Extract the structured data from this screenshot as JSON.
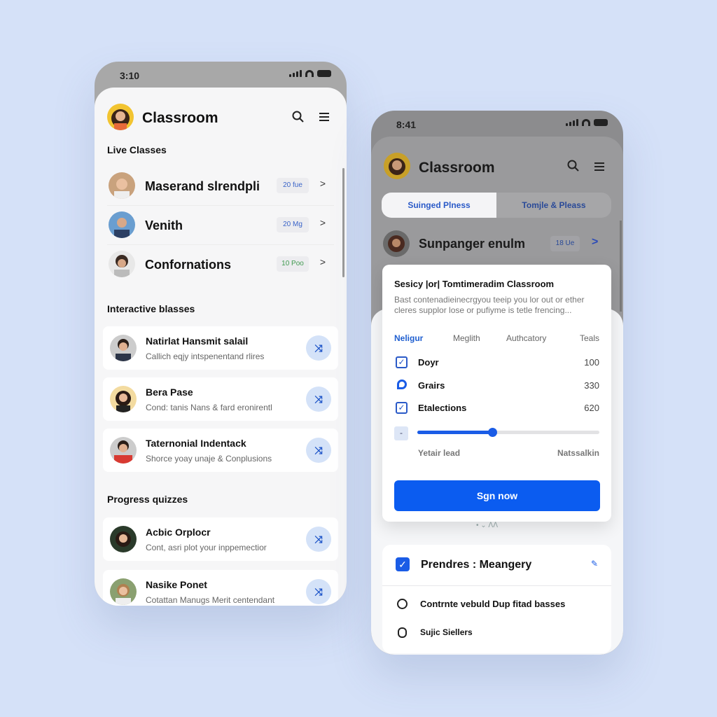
{
  "left_phone": {
    "status_time": "3:10",
    "app_title": "Classroom",
    "icons": {
      "search": "search-icon",
      "menu": "hamburger-menu-icon"
    },
    "live_classes": {
      "heading": "Live Classes",
      "items": [
        {
          "name": "Maserand slrendpli",
          "badge": "20 fue",
          "badge_color": "#3a64c8"
        },
        {
          "name": "Venith",
          "badge": "20 Mg",
          "badge_color": "#3a64c8"
        },
        {
          "name": "Confornations",
          "badge": "10 Poo",
          "badge_color": "#3f9a4f"
        }
      ]
    },
    "interactive_classes": {
      "heading": "Interactive blasses",
      "items": [
        {
          "title": "Natirlat Hansmit salail",
          "subtitle": "Callich eqjy intspenentand rlires"
        },
        {
          "title": "Bera Pase",
          "subtitle": "Cond: tanis Nans & fard eronirentl"
        },
        {
          "title": "Taternonial Indentack",
          "subtitle": "Shorce yoay unaje & Conplusions"
        }
      ]
    },
    "progress_quizzes": {
      "heading": "Progress quizzes",
      "items": [
        {
          "title": "Acbic Orplocr",
          "subtitle": "Cont, asri plot your inppemectior"
        },
        {
          "title": "Nasike Ponet",
          "subtitle": "Cotattan Manugs Merit centendant"
        }
      ]
    }
  },
  "right_phone": {
    "status_time": "8:41",
    "app_title": "Classroom",
    "tabs": [
      {
        "label": "Suinged Plness",
        "active": true
      },
      {
        "label": "Tomjle & Pleass",
        "active": false
      }
    ],
    "live_item": {
      "name": "Sunpanger enulm",
      "badge": "18 Ue"
    },
    "modal": {
      "title": "Sesicy |or| Tomtimeradim Classroom",
      "description": "Bast contenadieinecrgyou teeip you lor out or ether cleres supplor lose or pufiyme is tetle frencing...",
      "columns": [
        "Neligur",
        "Meglith",
        "Authcatory",
        "Teals"
      ],
      "rows": [
        {
          "label": "Doyr",
          "value": "100",
          "icon": "checkbox-icon"
        },
        {
          "label": "Grairs",
          "value": "330",
          "icon": "chat-bubble-icon"
        },
        {
          "label": "Etalections",
          "value": "620",
          "icon": "checkbox-icon"
        }
      ],
      "slider": {
        "value_percent": 41,
        "min_label": "Yetair lead",
        "max_label": "Natssalkin"
      },
      "button_label": "Sgn now",
      "accent": "#0b5cf0"
    },
    "sheet": {
      "header": "Prendres : Meangery",
      "items": [
        {
          "label": "Contrnte vebuld Dup fitad basses",
          "icon": "clock-icon"
        },
        {
          "label": "Sujic Siellers",
          "icon": "circle-info-icon"
        }
      ]
    }
  }
}
